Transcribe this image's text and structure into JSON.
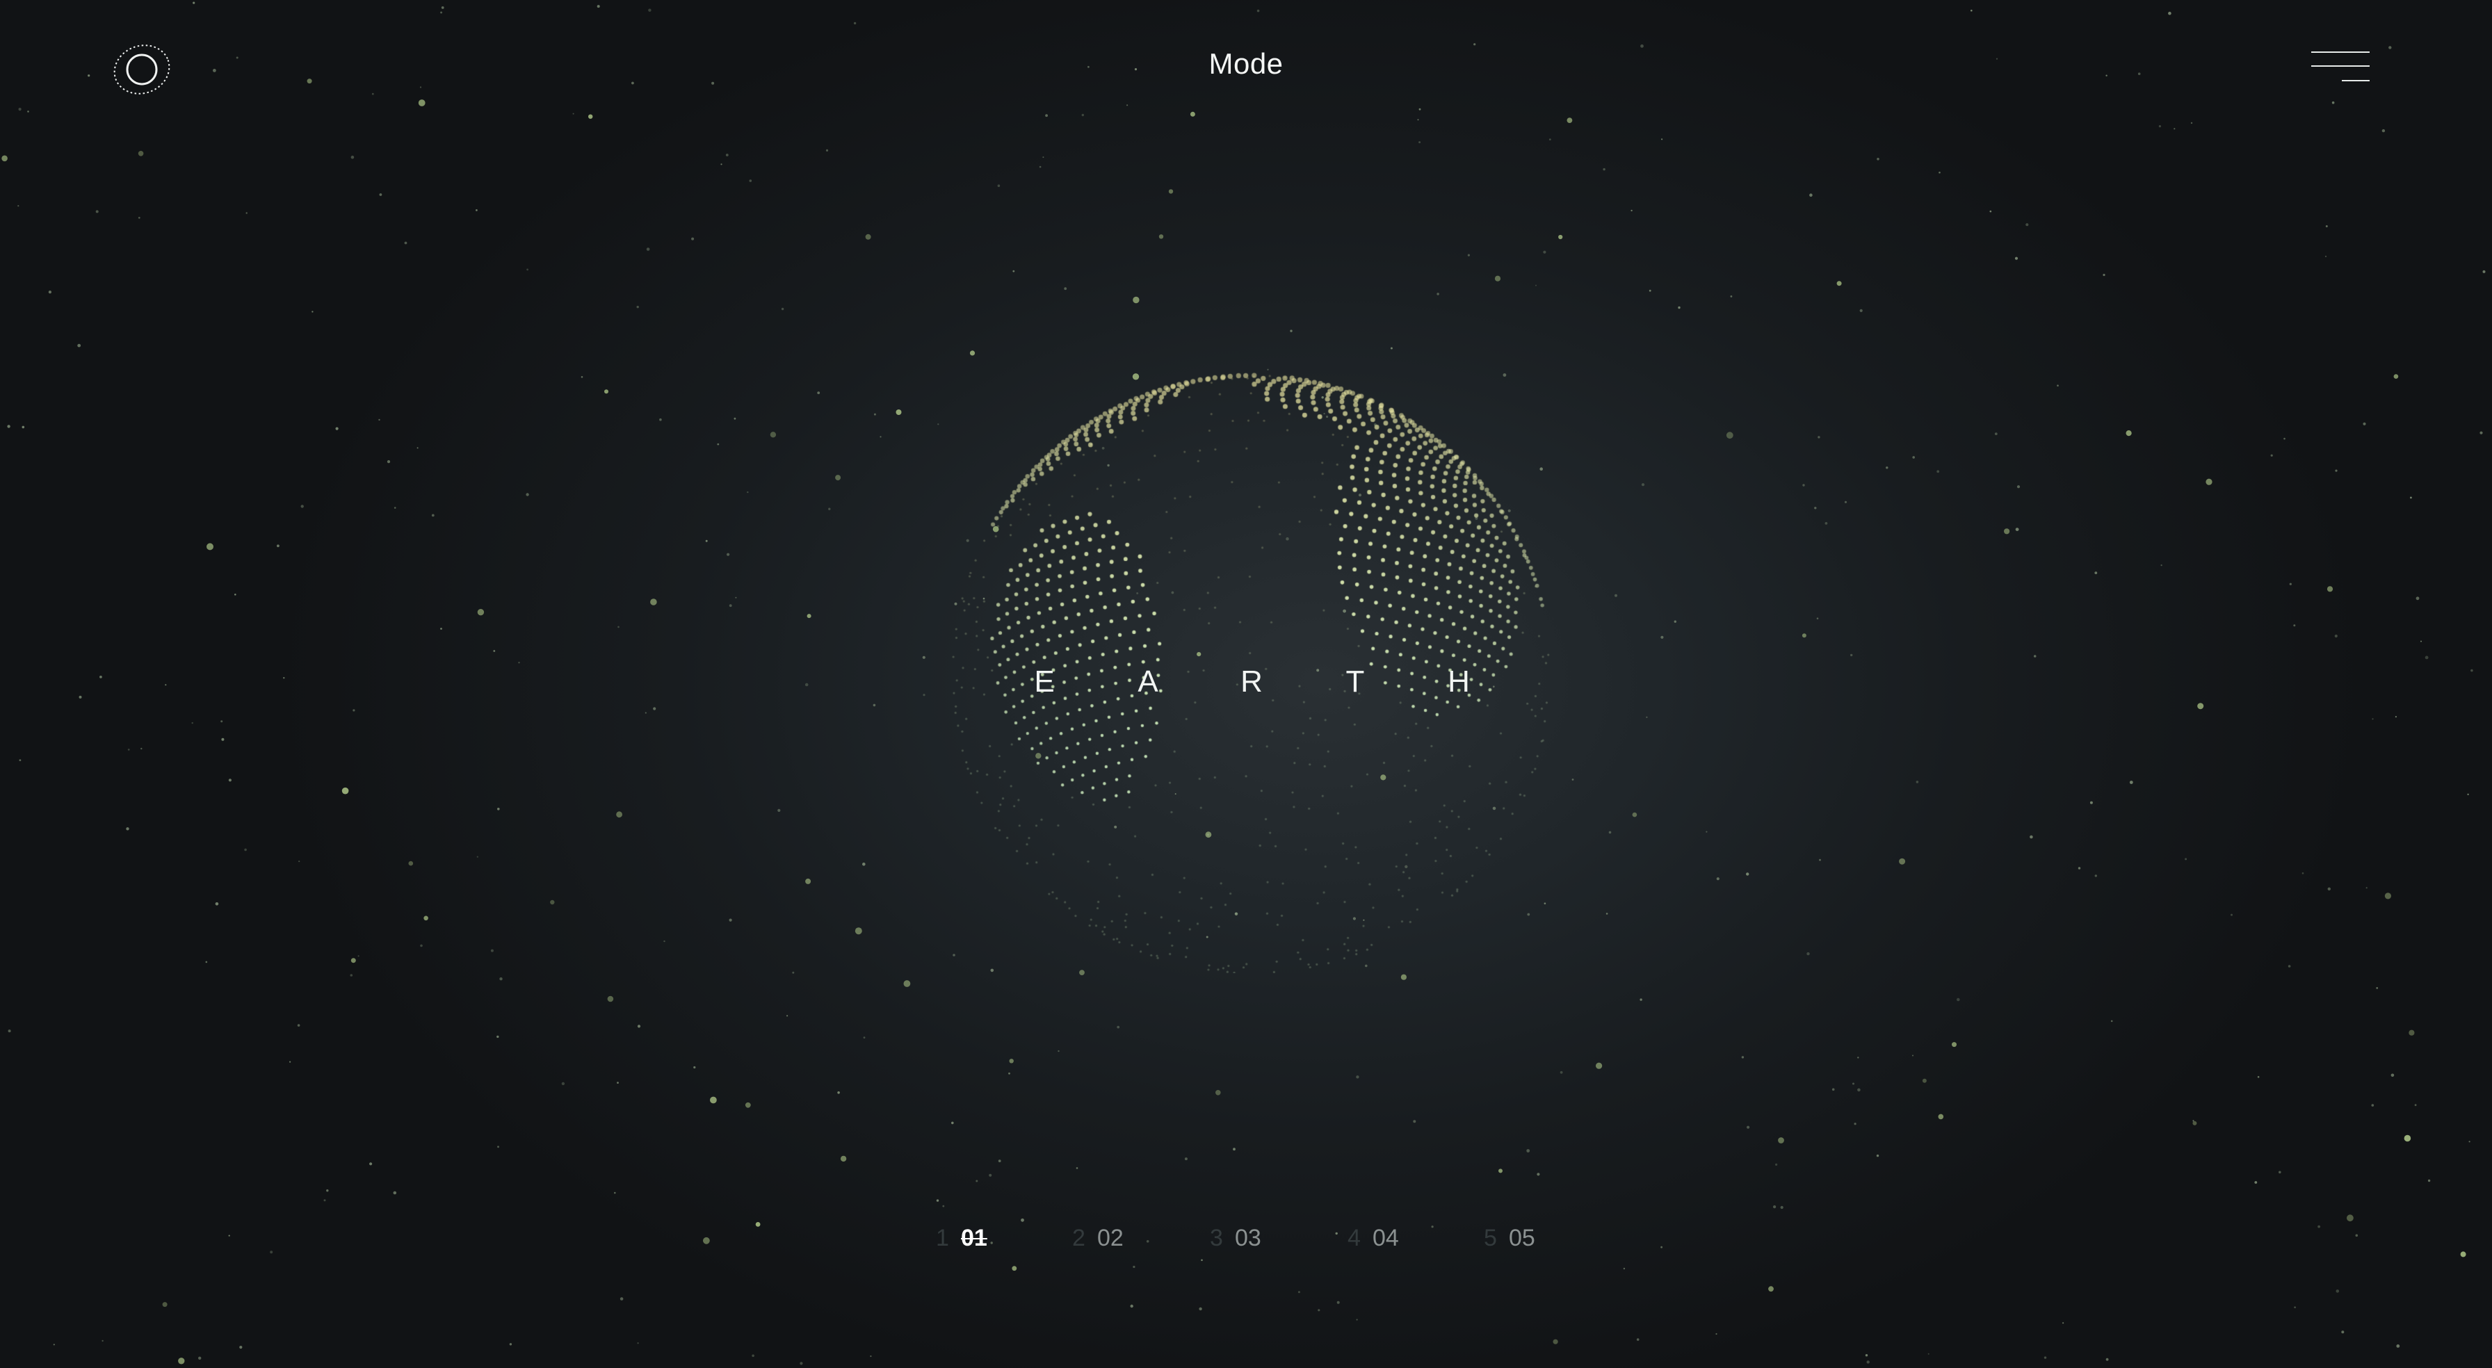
{
  "header": {
    "brand": "Mode",
    "logo_icon": "orbit-ring-icon",
    "menu_icon": "hamburger-menu-icon"
  },
  "hero": {
    "planet_letters": [
      "E",
      "A",
      "R",
      "T",
      "H"
    ],
    "visual": "dotted-globe"
  },
  "pager": {
    "items": [
      {
        "ghost": "1",
        "label": "01",
        "active": true
      },
      {
        "ghost": "2",
        "label": "02",
        "active": false
      },
      {
        "ghost": "3",
        "label": "03",
        "active": false
      },
      {
        "ghost": "4",
        "label": "04",
        "active": false
      },
      {
        "ghost": "5",
        "label": "05",
        "active": false
      }
    ]
  },
  "colors": {
    "background": "#1b2023",
    "accent_dot": "#cfe6b4",
    "text": "#f4f6f5",
    "muted": "#8b9191"
  }
}
